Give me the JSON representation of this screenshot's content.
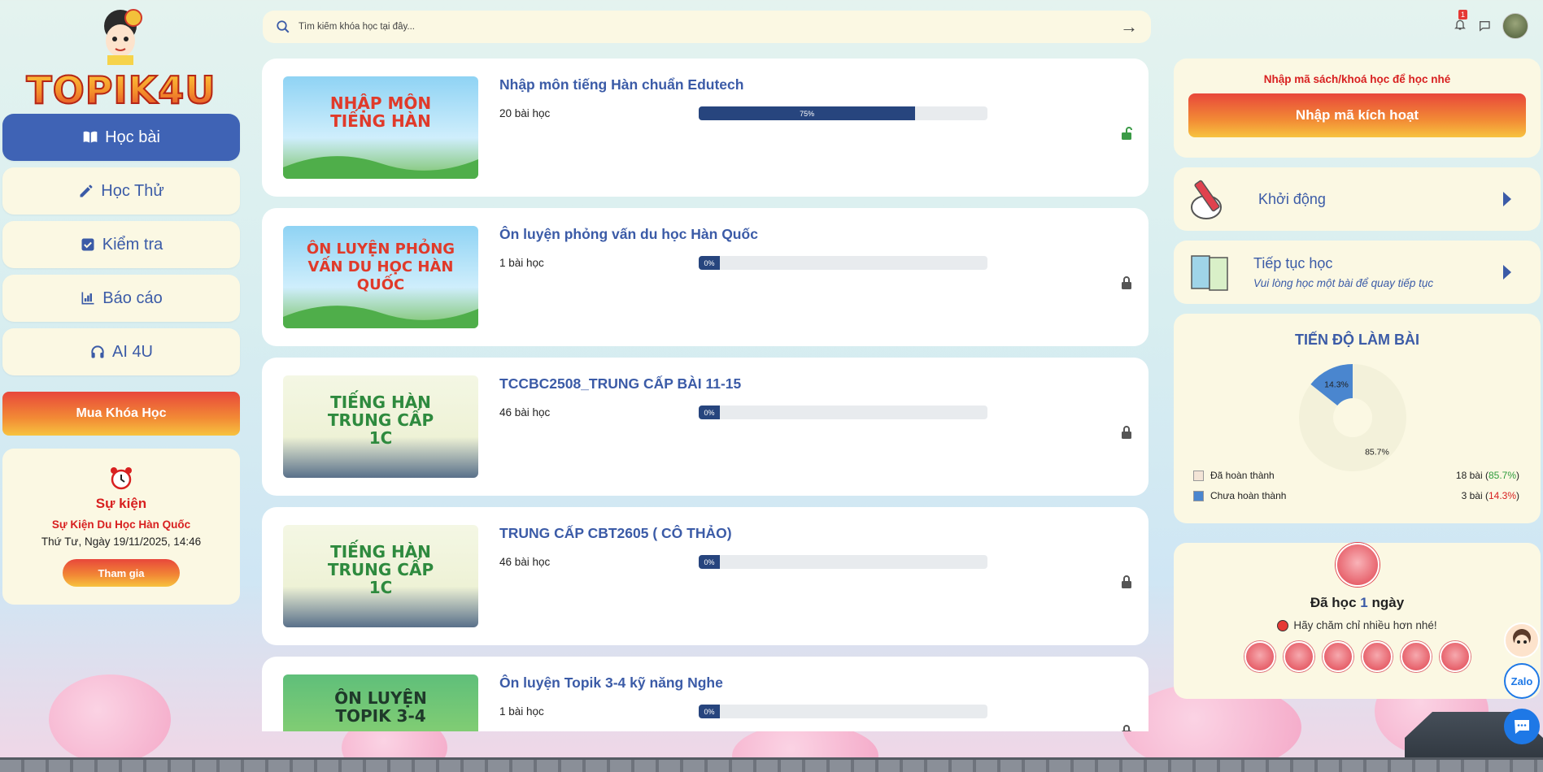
{
  "brand": {
    "logo_text": "TOPIK4U"
  },
  "sidebar": {
    "items": [
      {
        "label": "Học bài",
        "icon": "book-icon",
        "active": true
      },
      {
        "label": "Học Thử",
        "icon": "pencil-icon",
        "active": false
      },
      {
        "label": "Kiểm tra",
        "icon": "checkbox-icon",
        "active": false
      },
      {
        "label": "Báo cáo",
        "icon": "bar-chart-icon",
        "active": false
      },
      {
        "label": "AI 4U",
        "icon": "headphones-icon",
        "active": false
      }
    ],
    "buy_label": "Mua Khóa Học"
  },
  "event": {
    "icon": "alarm-clock-icon",
    "title": "Sự kiện",
    "name": "Sự Kiện Du Học Hàn Quốc",
    "date": "Thứ Tư, Ngày 19/11/2025, 14:46",
    "join_label": "Tham gia"
  },
  "search": {
    "placeholder": "Tìm kiếm khóa học tại đây...",
    "submit_icon": "arrow-right-icon"
  },
  "topbar": {
    "notification_count": "1",
    "icons": [
      "bell-icon",
      "chat-icon",
      "avatar"
    ]
  },
  "courses": [
    {
      "title": "Nhập môn tiếng Hàn chuẩn Edutech",
      "lessons": "20 bài học",
      "progress": 0.75,
      "progress_label": "75%",
      "locked": false,
      "thumb_text": "NHẬP MÔN TIẾNG HÀN",
      "thumb_color": "#e03a2a"
    },
    {
      "title": "Ôn luyện phỏng vấn du học Hàn Quốc",
      "lessons": "1 bài học",
      "progress": 0,
      "progress_label": "0%",
      "locked": true,
      "thumb_text": "ÔN LUYỆN PHỎNG VẤN DU HỌC HÀN QUỐC",
      "thumb_color": "#e03a2a"
    },
    {
      "title": "TCCBC2508_TRUNG CẤP BÀI 11-15",
      "lessons": "46 bài học",
      "progress": 0,
      "progress_label": "0%",
      "locked": true,
      "thumb_text": "TIẾNG HÀN TRUNG CẤP 1C",
      "thumb_color": "#2e8a3e"
    },
    {
      "title": "TRUNG CẤP CBT2605 ( CÔ THẢO)",
      "lessons": "46 bài học",
      "progress": 0,
      "progress_label": "0%",
      "locked": true,
      "thumb_text": "TIẾNG HÀN TRUNG CẤP 1C",
      "thumb_color": "#2e8a3e"
    },
    {
      "title": "Ôn luyện Topik 3-4 kỹ năng Nghe",
      "lessons": "1 bài học",
      "progress": 0,
      "progress_label": "0%",
      "locked": true,
      "thumb_text": "ÔN LUYỆN TOPIK 3-4",
      "thumb_color": "#1f3a2a"
    }
  ],
  "activate": {
    "hint": "Nhập mã sách/khoá học để học nhé",
    "button_label": "Nhập mã kích hoạt"
  },
  "warmup": {
    "title": "Khởi động",
    "icon": "pencil-book-icon"
  },
  "continue": {
    "title": "Tiếp tục học",
    "subtitle": "Vui lòng học một bài để quay tiếp tục",
    "icon": "open-book-icon"
  },
  "progress_panel": {
    "title": "TIẾN ĐỘ LÀM BÀI",
    "chart_data": {
      "type": "pie",
      "labels": [
        "Đã hoàn thành",
        "Chưa hoàn thành"
      ],
      "values": [
        85.7,
        14.3
      ],
      "value_labels": [
        "85.7%",
        "14.3%"
      ],
      "colors": [
        "#f3f1da",
        "#4a86cf"
      ]
    },
    "legend": [
      {
        "label": "Đã hoàn thành",
        "count": "18 bài",
        "pct": "85.7%",
        "color": "#f3e4d6"
      },
      {
        "label": "Chưa hoàn thành",
        "count": "3 bài",
        "pct": "14.3%",
        "color": "#4a86cf"
      }
    ]
  },
  "streak": {
    "prefix": "Đã học",
    "days": "1",
    "suffix": "ngày",
    "hint": "Hãy chăm chỉ nhiều hơn nhé!"
  },
  "floating": {
    "zalo_label": "Zalo"
  }
}
